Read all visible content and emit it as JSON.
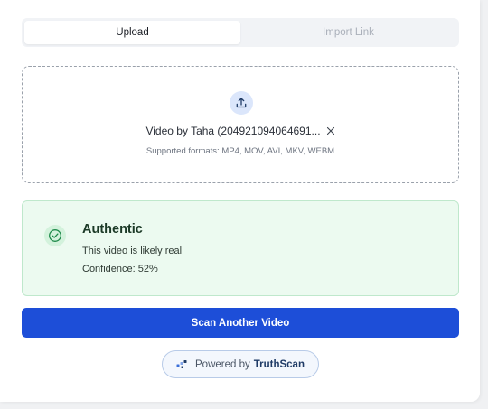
{
  "tabs": [
    {
      "label": "Upload",
      "active": true
    },
    {
      "label": "Import Link",
      "active": false
    }
  ],
  "dropzone": {
    "file_name": "Video by Taha (204921094064691...",
    "formats": "Supported formats: MP4, MOV, AVI, MKV, WEBM"
  },
  "result": {
    "title": "Authentic",
    "description": "This video is likely real",
    "confidence": "Confidence: 52%"
  },
  "scan_button": {
    "label": "Scan Another Video"
  },
  "powered": {
    "prefix": "Powered by",
    "brand": "TruthScan"
  },
  "colors": {
    "primary": "#1d4ed8",
    "success_bg": "#ecfaf0",
    "success_border": "#bfe8cc",
    "success_icon": "#1e8a4a"
  }
}
